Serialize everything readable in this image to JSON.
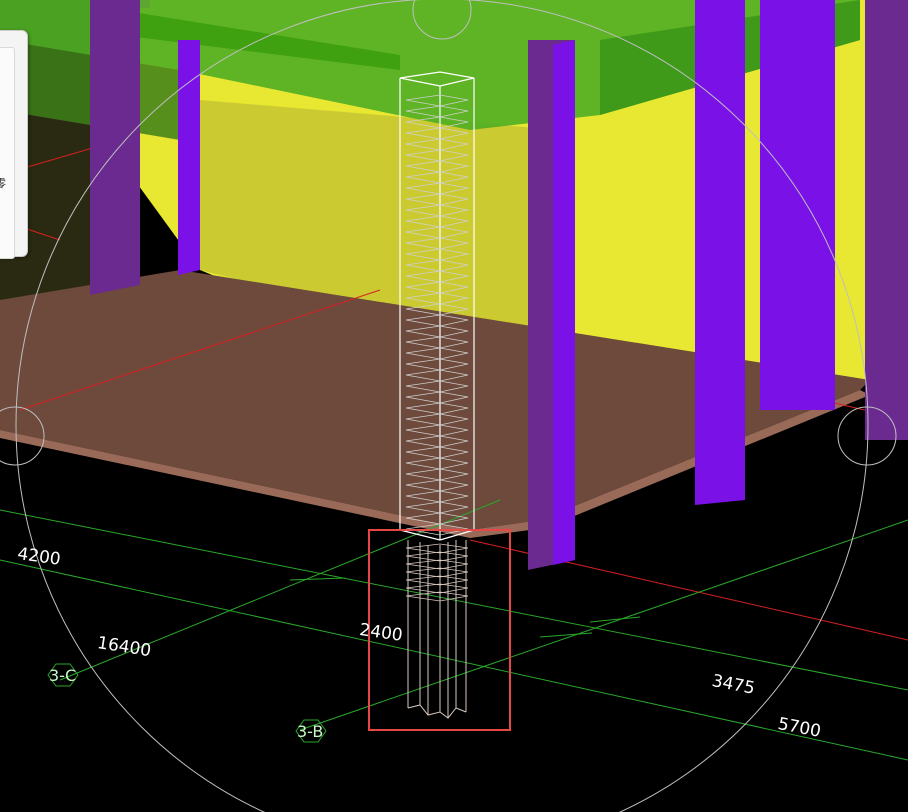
{
  "viewport": {
    "background": "#000000",
    "panel_glyph": "零"
  },
  "colors": {
    "slab": "#6e4a3c",
    "slab_edge": "#9a6a58",
    "beam": "#56b22a",
    "wall": "#e8e832",
    "column": "#7a12e8",
    "column_ghost": "#6a2a90",
    "grid_line": "#2aa82a",
    "ref_line": "#d82020",
    "selection_box": "#e64646",
    "rebar": "#d8c8c0",
    "orbit_circle": "#bfbfbf"
  },
  "dimensions": {
    "d1": "4200",
    "d2": "16400",
    "d3": "2400",
    "d4": "3475",
    "d5": "5700"
  },
  "axes": {
    "a1": "3-C",
    "a2": "3-B"
  }
}
